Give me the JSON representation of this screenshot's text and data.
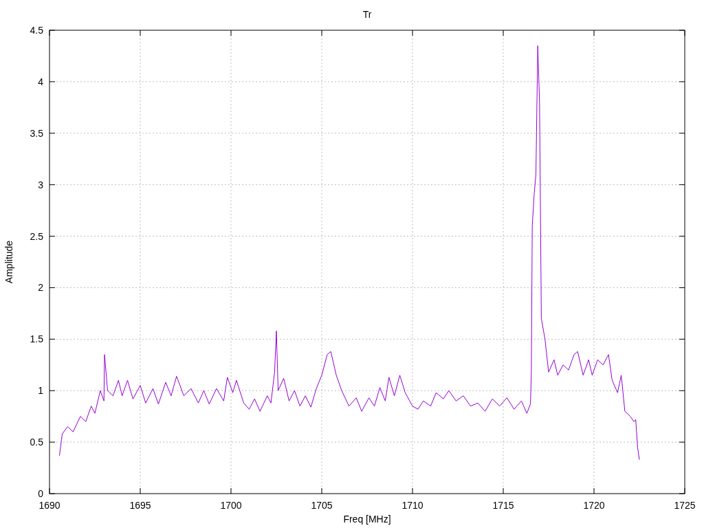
{
  "chart_data": {
    "type": "line",
    "title": "Tr",
    "xlabel": "Freq [MHz]",
    "ylabel": "Amplitude",
    "grid": true,
    "xlim": [
      1690,
      1725
    ],
    "ylim": [
      0,
      4.5
    ],
    "xticks": [
      1690,
      1695,
      1700,
      1705,
      1710,
      1715,
      1720,
      1725
    ],
    "yticks": [
      0,
      0.5,
      1,
      1.5,
      2,
      2.5,
      3,
      3.5,
      4,
      4.5
    ],
    "x": [
      1690.55,
      1690.7,
      1691,
      1691.3,
      1691.7,
      1692,
      1692.3,
      1692.5,
      1692.8,
      1693,
      1693.03,
      1693.2,
      1693.5,
      1693.8,
      1694,
      1694.3,
      1694.6,
      1695,
      1695.3,
      1695.7,
      1696,
      1696.4,
      1696.7,
      1697,
      1697.4,
      1697.8,
      1698.2,
      1698.5,
      1698.8,
      1699.2,
      1699.6,
      1699.8,
      1700.1,
      1700.3,
      1700.7,
      1701,
      1701.3,
      1701.6,
      1702,
      1702.2,
      1702.4,
      1702.5,
      1702.6,
      1702.9,
      1703.2,
      1703.5,
      1703.8,
      1704.1,
      1704.4,
      1704.7,
      1705,
      1705.3,
      1705.5,
      1705.8,
      1706.1,
      1706.5,
      1706.9,
      1707.2,
      1707.6,
      1707.9,
      1708.2,
      1708.5,
      1708.7,
      1709,
      1709.3,
      1709.6,
      1710,
      1710.3,
      1710.6,
      1711,
      1711.3,
      1711.7,
      1712,
      1712.4,
      1712.8,
      1713.2,
      1713.6,
      1714,
      1714.4,
      1714.8,
      1715.2,
      1715.6,
      1716,
      1716.3,
      1716.5,
      1716.55,
      1716.6,
      1716.7,
      1716.8,
      1716.9,
      1717,
      1717.1,
      1717.3,
      1717.5,
      1717.8,
      1718,
      1718.3,
      1718.6,
      1718.9,
      1719.1,
      1719.4,
      1719.7,
      1719.9,
      1720.2,
      1720.5,
      1720.8,
      1721,
      1721.3,
      1721.5,
      1721.7,
      1722,
      1722.2,
      1722.3,
      1722.4,
      1722.5
    ],
    "series": [
      {
        "color": "#9400d3",
        "values": [
          0.37,
          0.58,
          0.65,
          0.6,
          0.75,
          0.7,
          0.85,
          0.78,
          1.0,
          0.9,
          1.35,
          1.0,
          0.95,
          1.1,
          0.95,
          1.1,
          0.92,
          1.05,
          0.88,
          1.02,
          0.87,
          1.08,
          0.95,
          1.14,
          0.95,
          1.02,
          0.88,
          1.0,
          0.87,
          1.02,
          0.9,
          1.13,
          0.98,
          1.1,
          0.88,
          0.82,
          0.92,
          0.8,
          0.95,
          0.88,
          1.18,
          1.58,
          1.0,
          1.12,
          0.9,
          1.0,
          0.85,
          0.95,
          0.84,
          1.02,
          1.15,
          1.35,
          1.38,
          1.15,
          1.0,
          0.85,
          0.93,
          0.8,
          0.93,
          0.85,
          1.03,
          0.9,
          1.13,
          0.95,
          1.15,
          0.98,
          0.85,
          0.82,
          0.9,
          0.85,
          0.98,
          0.92,
          1.0,
          0.9,
          0.95,
          0.85,
          0.88,
          0.8,
          0.92,
          0.85,
          0.93,
          0.82,
          0.9,
          0.78,
          0.87,
          1.2,
          2.6,
          2.9,
          3.1,
          4.35,
          3.8,
          1.7,
          1.5,
          1.18,
          1.3,
          1.15,
          1.25,
          1.2,
          1.35,
          1.38,
          1.15,
          1.3,
          1.15,
          1.3,
          1.25,
          1.35,
          1.1,
          0.98,
          1.15,
          0.8,
          0.75,
          0.7,
          0.72,
          0.45,
          0.33
        ]
      }
    ]
  }
}
